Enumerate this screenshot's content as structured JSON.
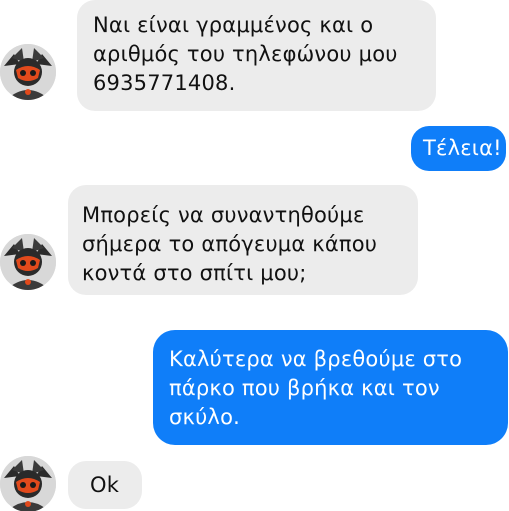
{
  "conversation": {
    "messages": [
      {
        "direction": "incoming",
        "lines": [
          "Ναι είναι γραμμένος και ο",
          "αριθμός του τηλεφώνου μου",
          "6935771408."
        ]
      },
      {
        "direction": "outgoing",
        "lines": [
          "Τέλεια!"
        ]
      },
      {
        "direction": "incoming",
        "lines": [
          "Μπορείς να συναντηθούμε",
          "σήμερα το απόγευμα κάπου",
          "κοντά στο σπίτι μου;"
        ]
      },
      {
        "direction": "outgoing",
        "lines": [
          "Καλύτερα να βρεθούμε στο",
          "πάρκο που βρήκα και τον",
          "σκύλο."
        ]
      },
      {
        "direction": "incoming",
        "lines": [
          "Ok"
        ]
      }
    ]
  },
  "icons": {
    "contact_avatar": "dark-masked-character-avatar-icon"
  },
  "colors": {
    "incoming_bubble": "#ececec",
    "outgoing_bubble": "#0f7ef9",
    "outgoing_text": "#ffffff",
    "avatar_accent": "#e24a1c"
  }
}
